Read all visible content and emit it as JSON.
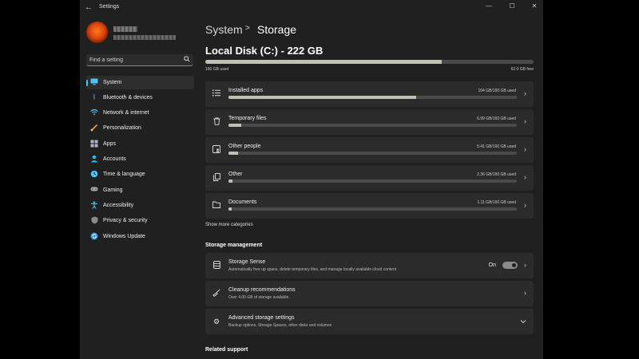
{
  "window": {
    "title": "Settings",
    "back_glyph": "←",
    "minimize": "—",
    "maximize": "☐",
    "close": "✕"
  },
  "user": {
    "name": "",
    "email": ""
  },
  "search": {
    "placeholder": "Find a setting"
  },
  "sidebar": {
    "items": [
      {
        "label": "System",
        "icon": "monitor-icon",
        "color": "#4cc2ff",
        "active": true
      },
      {
        "label": "Bluetooth & devices",
        "icon": "bluetooth-icon",
        "color": "#4cc2ff"
      },
      {
        "label": "Network & internet",
        "icon": "wifi-icon",
        "color": "#4cc2ff"
      },
      {
        "label": "Personalization",
        "icon": "brush-icon",
        "color": "#e8a04a"
      },
      {
        "label": "Apps",
        "icon": "apps-icon",
        "color": "#aab8c8"
      },
      {
        "label": "Accounts",
        "icon": "person-icon",
        "color": "#2fb5e8"
      },
      {
        "label": "Time & language",
        "icon": "globe-clock-icon",
        "color": "#4cc2ff"
      },
      {
        "label": "Gaming",
        "icon": "controller-icon",
        "color": "#aaaaaa"
      },
      {
        "label": "Accessibility",
        "icon": "accessibility-icon",
        "color": "#4cc2ff"
      },
      {
        "label": "Privacy & security",
        "icon": "shield-icon",
        "color": "#8a8a8a"
      },
      {
        "label": "Windows Update",
        "icon": "update-icon",
        "color": "#2f9be0"
      }
    ]
  },
  "breadcrumb": {
    "parent": "System",
    "separator": ">",
    "current": "Storage"
  },
  "disk": {
    "title": "Local Disk (C:) - 222 GB",
    "used_label": "160 GB used",
    "free_label": "62.0 GB free",
    "used_fraction": 0.72
  },
  "categories": [
    {
      "label": "Installed apps",
      "size": "104 GB/160 GB used",
      "fraction": 0.65,
      "icon": "list-icon"
    },
    {
      "label": "Temporary files",
      "size": "6.99 GB/160 GB used",
      "fraction": 0.044,
      "icon": "trash-icon"
    },
    {
      "label": "Other people",
      "size": "5.41 GB/160 GB used",
      "fraction": 0.034,
      "icon": "people-icon"
    },
    {
      "label": "Other",
      "size": "2.36 GB/160 GB used",
      "fraction": 0.015,
      "icon": "document-icon"
    },
    {
      "label": "Documents",
      "size": "1.11 GB/160 GB used",
      "fraction": 0.007,
      "icon": "folder-icon"
    }
  ],
  "show_more": "Show more categories",
  "storage_management": {
    "heading": "Storage management",
    "items": [
      {
        "title": "Storage Sense",
        "description": "Automatically free up space, delete temporary files, and manage locally available cloud content",
        "icon": "database-icon",
        "toggle_label": "On",
        "toggle_on": true
      },
      {
        "title": "Cleanup recommendations",
        "description": "Over 4.00 GB of storage available.",
        "icon": "broom-icon"
      },
      {
        "title": "Advanced storage settings",
        "description": "Backup options, Storage Spaces, other disks and volumes",
        "icon": "gear-icon"
      }
    ]
  },
  "related_support": {
    "heading": "Related support"
  },
  "colors": {
    "accent": "#4cc2ff",
    "bar_fill": "#c0c0b4",
    "bar_track": "#4a4a4a",
    "card": "#2b2b2b",
    "window": "#202020"
  }
}
